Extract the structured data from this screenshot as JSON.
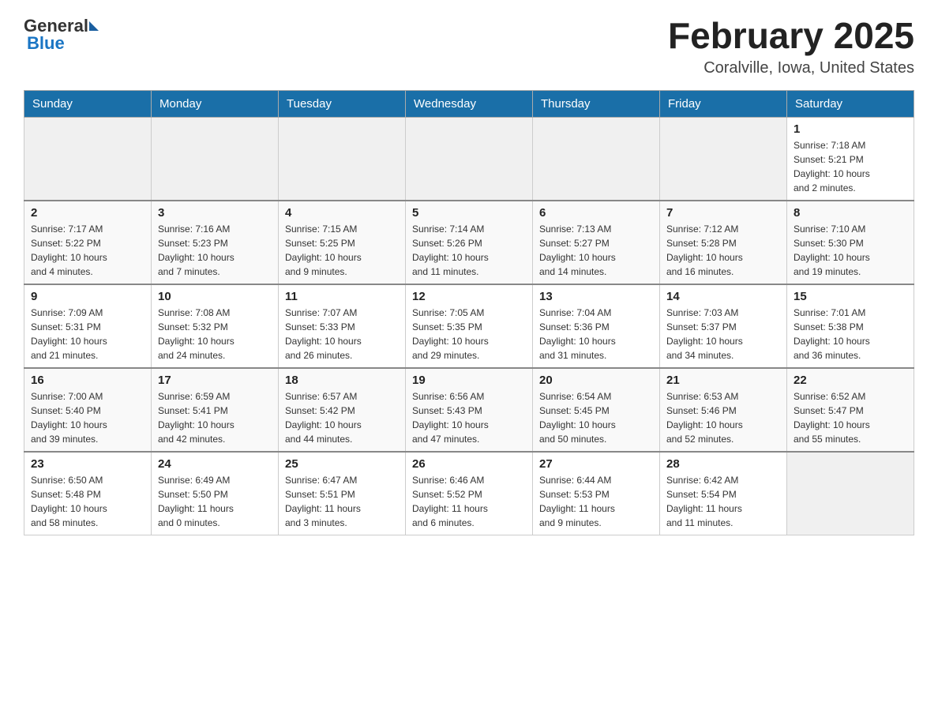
{
  "header": {
    "logo_general": "General",
    "logo_blue": "Blue",
    "month_title": "February 2025",
    "location": "Coralville, Iowa, United States"
  },
  "weekdays": [
    "Sunday",
    "Monday",
    "Tuesday",
    "Wednesday",
    "Thursday",
    "Friday",
    "Saturday"
  ],
  "weeks": [
    [
      {
        "day": "",
        "info": ""
      },
      {
        "day": "",
        "info": ""
      },
      {
        "day": "",
        "info": ""
      },
      {
        "day": "",
        "info": ""
      },
      {
        "day": "",
        "info": ""
      },
      {
        "day": "",
        "info": ""
      },
      {
        "day": "1",
        "info": "Sunrise: 7:18 AM\nSunset: 5:21 PM\nDaylight: 10 hours\nand 2 minutes."
      }
    ],
    [
      {
        "day": "2",
        "info": "Sunrise: 7:17 AM\nSunset: 5:22 PM\nDaylight: 10 hours\nand 4 minutes."
      },
      {
        "day": "3",
        "info": "Sunrise: 7:16 AM\nSunset: 5:23 PM\nDaylight: 10 hours\nand 7 minutes."
      },
      {
        "day": "4",
        "info": "Sunrise: 7:15 AM\nSunset: 5:25 PM\nDaylight: 10 hours\nand 9 minutes."
      },
      {
        "day": "5",
        "info": "Sunrise: 7:14 AM\nSunset: 5:26 PM\nDaylight: 10 hours\nand 11 minutes."
      },
      {
        "day": "6",
        "info": "Sunrise: 7:13 AM\nSunset: 5:27 PM\nDaylight: 10 hours\nand 14 minutes."
      },
      {
        "day": "7",
        "info": "Sunrise: 7:12 AM\nSunset: 5:28 PM\nDaylight: 10 hours\nand 16 minutes."
      },
      {
        "day": "8",
        "info": "Sunrise: 7:10 AM\nSunset: 5:30 PM\nDaylight: 10 hours\nand 19 minutes."
      }
    ],
    [
      {
        "day": "9",
        "info": "Sunrise: 7:09 AM\nSunset: 5:31 PM\nDaylight: 10 hours\nand 21 minutes."
      },
      {
        "day": "10",
        "info": "Sunrise: 7:08 AM\nSunset: 5:32 PM\nDaylight: 10 hours\nand 24 minutes."
      },
      {
        "day": "11",
        "info": "Sunrise: 7:07 AM\nSunset: 5:33 PM\nDaylight: 10 hours\nand 26 minutes."
      },
      {
        "day": "12",
        "info": "Sunrise: 7:05 AM\nSunset: 5:35 PM\nDaylight: 10 hours\nand 29 minutes."
      },
      {
        "day": "13",
        "info": "Sunrise: 7:04 AM\nSunset: 5:36 PM\nDaylight: 10 hours\nand 31 minutes."
      },
      {
        "day": "14",
        "info": "Sunrise: 7:03 AM\nSunset: 5:37 PM\nDaylight: 10 hours\nand 34 minutes."
      },
      {
        "day": "15",
        "info": "Sunrise: 7:01 AM\nSunset: 5:38 PM\nDaylight: 10 hours\nand 36 minutes."
      }
    ],
    [
      {
        "day": "16",
        "info": "Sunrise: 7:00 AM\nSunset: 5:40 PM\nDaylight: 10 hours\nand 39 minutes."
      },
      {
        "day": "17",
        "info": "Sunrise: 6:59 AM\nSunset: 5:41 PM\nDaylight: 10 hours\nand 42 minutes."
      },
      {
        "day": "18",
        "info": "Sunrise: 6:57 AM\nSunset: 5:42 PM\nDaylight: 10 hours\nand 44 minutes."
      },
      {
        "day": "19",
        "info": "Sunrise: 6:56 AM\nSunset: 5:43 PM\nDaylight: 10 hours\nand 47 minutes."
      },
      {
        "day": "20",
        "info": "Sunrise: 6:54 AM\nSunset: 5:45 PM\nDaylight: 10 hours\nand 50 minutes."
      },
      {
        "day": "21",
        "info": "Sunrise: 6:53 AM\nSunset: 5:46 PM\nDaylight: 10 hours\nand 52 minutes."
      },
      {
        "day": "22",
        "info": "Sunrise: 6:52 AM\nSunset: 5:47 PM\nDaylight: 10 hours\nand 55 minutes."
      }
    ],
    [
      {
        "day": "23",
        "info": "Sunrise: 6:50 AM\nSunset: 5:48 PM\nDaylight: 10 hours\nand 58 minutes."
      },
      {
        "day": "24",
        "info": "Sunrise: 6:49 AM\nSunset: 5:50 PM\nDaylight: 11 hours\nand 0 minutes."
      },
      {
        "day": "25",
        "info": "Sunrise: 6:47 AM\nSunset: 5:51 PM\nDaylight: 11 hours\nand 3 minutes."
      },
      {
        "day": "26",
        "info": "Sunrise: 6:46 AM\nSunset: 5:52 PM\nDaylight: 11 hours\nand 6 minutes."
      },
      {
        "day": "27",
        "info": "Sunrise: 6:44 AM\nSunset: 5:53 PM\nDaylight: 11 hours\nand 9 minutes."
      },
      {
        "day": "28",
        "info": "Sunrise: 6:42 AM\nSunset: 5:54 PM\nDaylight: 11 hours\nand 11 minutes."
      },
      {
        "day": "",
        "info": ""
      }
    ]
  ]
}
